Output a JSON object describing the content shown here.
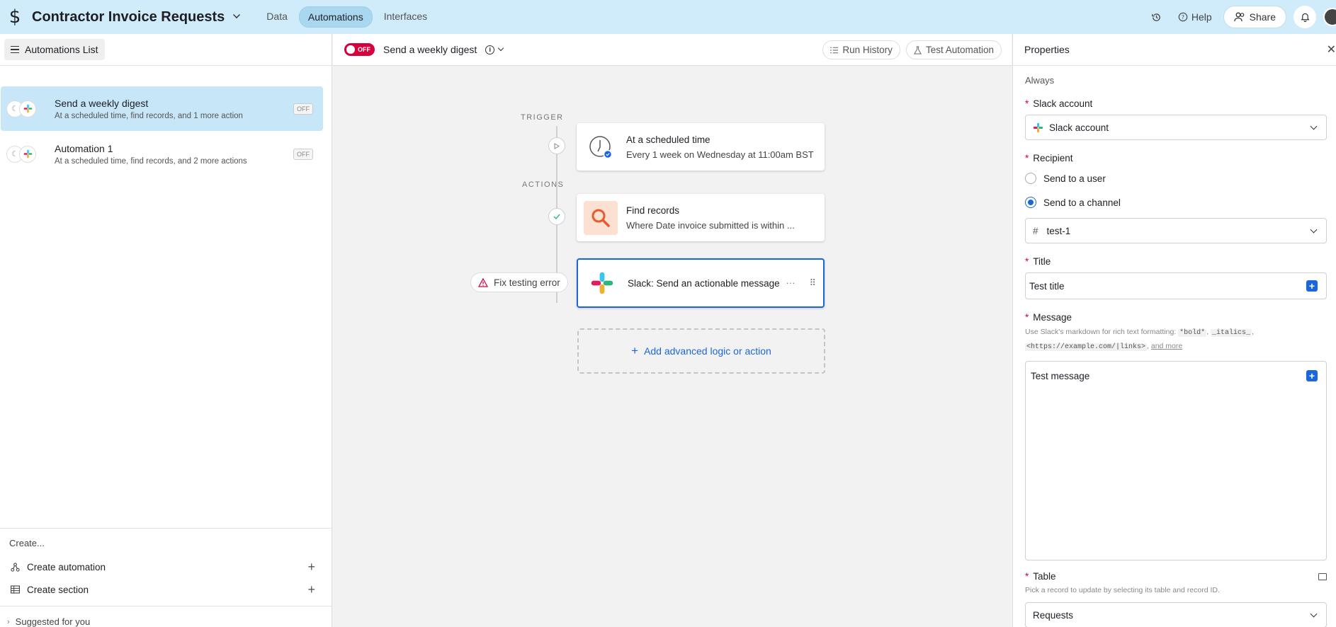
{
  "topbar": {
    "logo_glyph": "$",
    "title": "Contractor Invoice Requests",
    "tabs": [
      "Data",
      "Automations",
      "Interfaces"
    ],
    "help_label": "Help",
    "share_label": "Share"
  },
  "leftpanel": {
    "list_button": "Automations List",
    "automations": [
      {
        "name": "Send a weekly digest",
        "desc": "At a scheduled time, find records, and 1 more action",
        "status": "OFF"
      },
      {
        "name": "Automation 1",
        "desc": "At a scheduled time, find records, and 2 more actions",
        "status": "OFF"
      }
    ],
    "create_label": "Create...",
    "create_automation": "Create automation",
    "create_section": "Create section",
    "suggested": "Suggested for you"
  },
  "canvas_header": {
    "toggle_label": "OFF",
    "title": "Send a weekly digest",
    "run_history": "Run History",
    "test_automation": "Test Automation"
  },
  "canvas": {
    "trigger_label": "TRIGGER",
    "actions_label": "ACTIONS",
    "trigger_card": {
      "title": "At a scheduled time",
      "sub": "Every 1 week on Wednesday at 11:00am BST"
    },
    "find_card": {
      "title": "Find records",
      "sub": "Where Date invoice submitted is within ..."
    },
    "slack_card": {
      "title": "Slack: Send an actionable message"
    },
    "fix_error": "Fix testing error",
    "add_logic": "Add advanced logic or action"
  },
  "properties": {
    "header": "Properties",
    "always": "Always",
    "slack_account_label": "Slack account",
    "slack_account_value": "Slack account",
    "recipient_label": "Recipient",
    "recipient_options": [
      "Send to a user",
      "Send to a channel"
    ],
    "recipient_selected": "Send to a channel",
    "channel_value": "test-1",
    "title_label": "Title",
    "title_value": "Test title",
    "message_label": "Message",
    "message_hint_prefix": "Use Slack's markdown for rich text formatting: ",
    "hint_bold": "*bold*",
    "hint_italics": "_italics_",
    "hint_link": "<https://example.com/|links>",
    "hint_more": "and more",
    "message_value": "Test message",
    "table_label": "Table",
    "table_hint": "Pick a record to update by selecting its table and record ID.",
    "table_value": "Requests"
  },
  "colors": {
    "topbar_bg": "#d0ebf9",
    "accent": "#1a66db",
    "toggle_off": "#d6003c",
    "selected_item_bg": "#c7e6f8"
  }
}
